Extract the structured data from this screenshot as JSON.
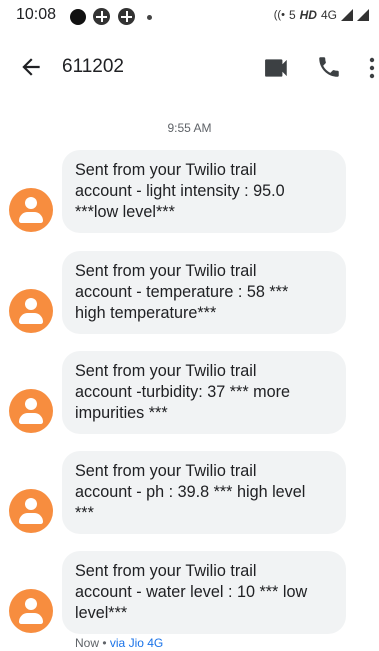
{
  "status_bar": {
    "time": "10:08",
    "right_text": "5",
    "network_label": "HD",
    "network_type": "4G"
  },
  "app_bar": {
    "title": "611202"
  },
  "conversation": {
    "timestamp": "9:55 AM",
    "messages": [
      {
        "text": "Sent from your Twilio trail\naccount - light intensity : 95.0\n***low level***"
      },
      {
        "text": "Sent from your Twilio trail\naccount - temperature : 58 ***\nhigh temperature***"
      },
      {
        "text": "Sent from your Twilio trail\naccount -turbidity: 37 *** more\nimpurities ***"
      },
      {
        "text": "Sent from your Twilio trail\naccount - ph : 39.8 *** high level\n***"
      },
      {
        "text": "Sent from your Twilio trail\naccount - water level : 10 *** low\nlevel***"
      }
    ],
    "footer_status": "Now",
    "footer_separator": " • ",
    "footer_via": "via Jio 4G"
  },
  "colors": {
    "avatar": "#f78d3f",
    "bubble": "#f1f3f4",
    "link": "#1a73e8"
  }
}
